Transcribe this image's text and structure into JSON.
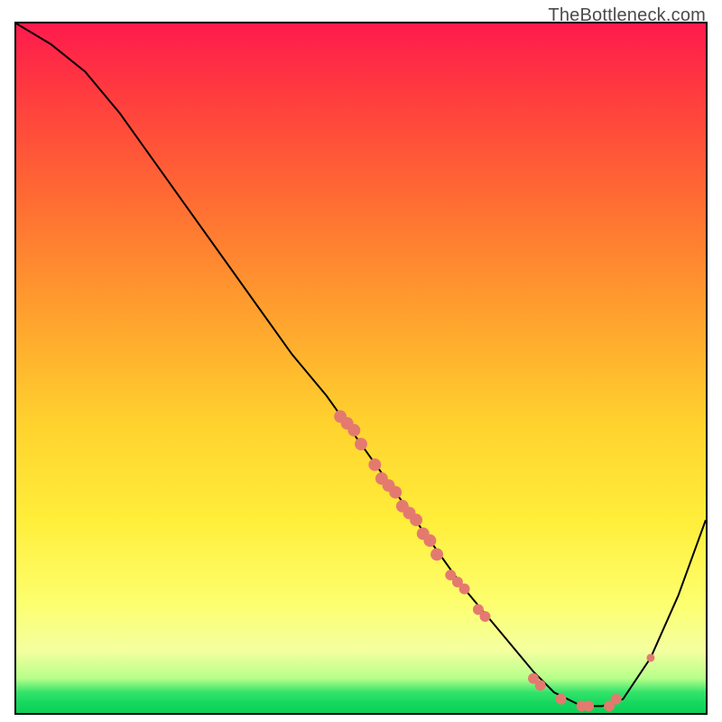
{
  "watermark": "TheBottleneck.com",
  "chart_data": {
    "type": "line",
    "title": "",
    "xlabel": "",
    "ylabel": "",
    "xlim": [
      0,
      100
    ],
    "ylim": [
      0,
      100
    ],
    "grid": false,
    "legend": false,
    "series": [
      {
        "name": "curve",
        "x": [
          0,
          5,
          10,
          15,
          20,
          25,
          30,
          35,
          40,
          45,
          50,
          55,
          60,
          65,
          70,
          75,
          78,
          82,
          85,
          88,
          92,
          96,
          100
        ],
        "y": [
          100,
          97,
          93,
          87,
          80,
          73,
          66,
          59,
          52,
          46,
          39,
          32,
          25,
          18,
          12,
          6,
          3,
          1,
          1,
          2,
          8,
          17,
          28
        ]
      }
    ],
    "points": [
      {
        "x": 47,
        "y": 43,
        "size": "big"
      },
      {
        "x": 48,
        "y": 42,
        "size": "big"
      },
      {
        "x": 49,
        "y": 41,
        "size": "big"
      },
      {
        "x": 50,
        "y": 39,
        "size": "big"
      },
      {
        "x": 52,
        "y": 36,
        "size": "big"
      },
      {
        "x": 53,
        "y": 34,
        "size": "big"
      },
      {
        "x": 54,
        "y": 33,
        "size": "big"
      },
      {
        "x": 55,
        "y": 32,
        "size": "big"
      },
      {
        "x": 56,
        "y": 30,
        "size": "big"
      },
      {
        "x": 57,
        "y": 29,
        "size": "big"
      },
      {
        "x": 58,
        "y": 28,
        "size": "big"
      },
      {
        "x": 59,
        "y": 26,
        "size": "big"
      },
      {
        "x": 60,
        "y": 25,
        "size": "big"
      },
      {
        "x": 61,
        "y": 23,
        "size": "big"
      },
      {
        "x": 63,
        "y": 20,
        "size": "med"
      },
      {
        "x": 64,
        "y": 19,
        "size": "med"
      },
      {
        "x": 65,
        "y": 18,
        "size": "med"
      },
      {
        "x": 67,
        "y": 15,
        "size": "med"
      },
      {
        "x": 68,
        "y": 14,
        "size": "med"
      },
      {
        "x": 75,
        "y": 5,
        "size": "med"
      },
      {
        "x": 76,
        "y": 4,
        "size": "med"
      },
      {
        "x": 79,
        "y": 2,
        "size": "med"
      },
      {
        "x": 82,
        "y": 1,
        "size": "med"
      },
      {
        "x": 83,
        "y": 1,
        "size": "med"
      },
      {
        "x": 86,
        "y": 1,
        "size": "med"
      },
      {
        "x": 87,
        "y": 2,
        "size": "med"
      },
      {
        "x": 92,
        "y": 8,
        "size": "sm"
      }
    ],
    "gradient_stops": [
      {
        "pos": 0,
        "color": "#ff1a4d"
      },
      {
        "pos": 25,
        "color": "#ff6a33"
      },
      {
        "pos": 58,
        "color": "#ffd22e"
      },
      {
        "pos": 84,
        "color": "#fdff6e"
      },
      {
        "pos": 97,
        "color": "#34e36b"
      },
      {
        "pos": 100,
        "color": "#0ecf56"
      }
    ]
  }
}
